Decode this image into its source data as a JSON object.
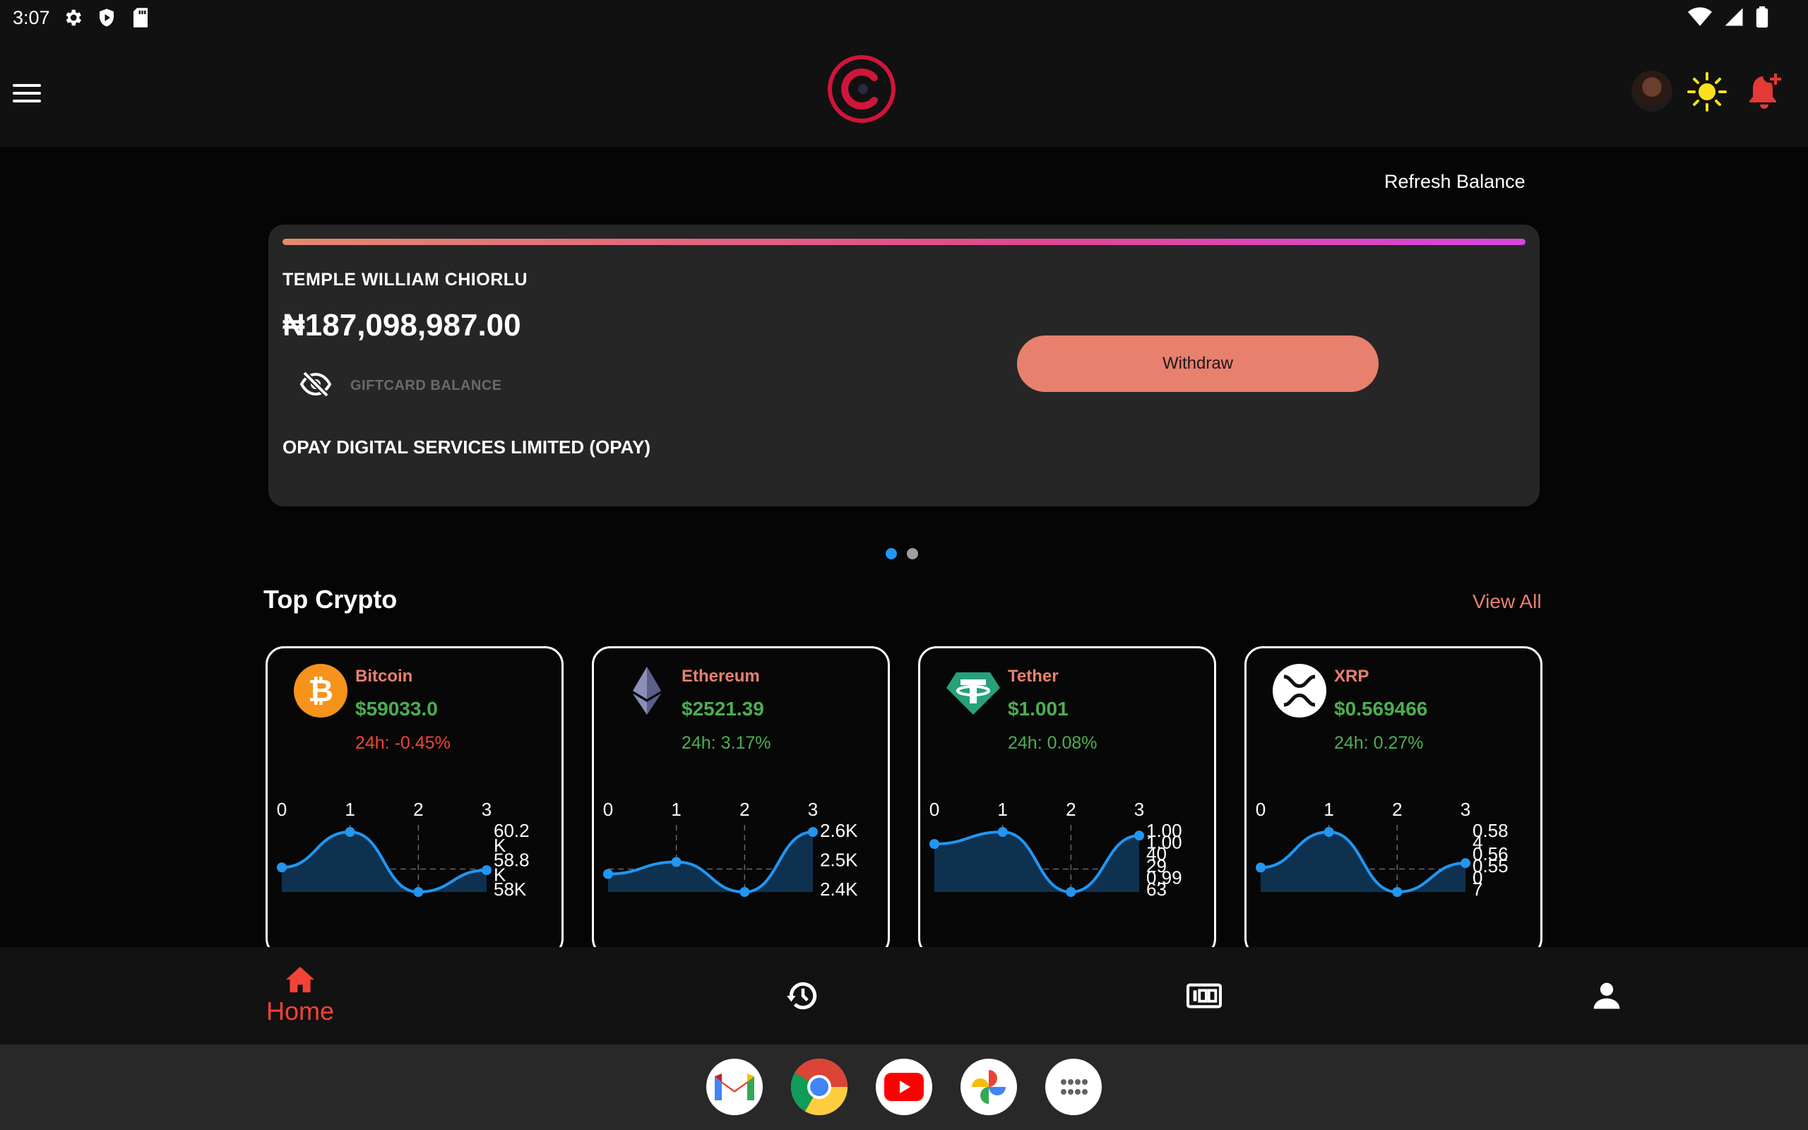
{
  "status_bar": {
    "time": "3:07",
    "icons": [
      "gear-icon",
      "shield-play-icon",
      "sd-card-icon"
    ],
    "right_icons": [
      "wifi-icon",
      "signal-icon",
      "battery-icon"
    ]
  },
  "app_bar": {
    "menu_icon": "hamburger-menu-icon",
    "logo": "brand-logo",
    "actions": [
      "avatar",
      "sun-icon",
      "bell-plus-icon"
    ],
    "brand_color": "#d0153a"
  },
  "refresh_label": "Refresh Balance",
  "balance_card": {
    "holder_name": "TEMPLE WILLIAM CHIORLU",
    "amount": "₦187,098,987.00",
    "giftcard_label": "GIFTCARD BALANCE",
    "bank_name": "OPAY DIGITAL SERVICES LIMITED (OPAY)",
    "withdraw_label": "Withdraw",
    "accent_color": "#e8806e"
  },
  "carousel": {
    "pages": 2,
    "active_page": 1
  },
  "top_crypto": {
    "title": "Top Crypto",
    "view_all_label": "View All",
    "coins": [
      {
        "name": "Bitcoin",
        "price": "$59033.0",
        "change": "24h: -0.45%",
        "direction": "neg",
        "icon": "bitcoin-icon",
        "x_ticks": [
          "0",
          "1",
          "2",
          "3"
        ],
        "y_labels": [
          "60.2",
          "K",
          "58.8",
          "K",
          "58K"
        ],
        "values": [
          58.9,
          60.2,
          58.0,
          58.8
        ]
      },
      {
        "name": "Ethereum",
        "price": "$2521.39",
        "change": "24h: 3.17%",
        "direction": "pos",
        "icon": "ethereum-icon",
        "x_ticks": [
          "0",
          "1",
          "2",
          "3"
        ],
        "y_labels": [
          "2.6K",
          "2.5K",
          "2.4K"
        ],
        "values": [
          2.46,
          2.5,
          2.4,
          2.6
        ]
      },
      {
        "name": "Tether",
        "price": "$1.001",
        "change": "24h: 0.08%",
        "direction": "pos",
        "icon": "tether-icon",
        "x_ticks": [
          "0",
          "1",
          "2",
          "3"
        ],
        "y_labels": [
          "1.00",
          "1.00",
          "40",
          "29",
          "0.99",
          "63"
        ],
        "values": [
          1.0003,
          1.0013,
          0.9963,
          1.001
        ]
      },
      {
        "name": "XRP",
        "price": "$0.569466",
        "change": "24h: 0.27%",
        "direction": "pos",
        "icon": "xrp-icon",
        "x_ticks": [
          "0",
          "1",
          "2",
          "3"
        ],
        "y_labels": [
          "0.58",
          "4",
          "0.56",
          "0.55",
          "0",
          "7"
        ],
        "values": [
          0.568,
          0.584,
          0.557,
          0.57
        ]
      }
    ]
  },
  "bottom_nav": {
    "items": [
      {
        "label": "Home",
        "icon": "home-icon",
        "active": true
      },
      {
        "label": "",
        "icon": "history-icon",
        "active": false
      },
      {
        "label": "",
        "icon": "giftcard-icon",
        "active": false
      },
      {
        "label": "",
        "icon": "profile-icon",
        "active": false
      }
    ],
    "active_color": "#f44336"
  },
  "dock": {
    "apps": [
      "gmail-icon",
      "chrome-icon",
      "youtube-icon",
      "photos-icon",
      "app-drawer-icon"
    ]
  }
}
